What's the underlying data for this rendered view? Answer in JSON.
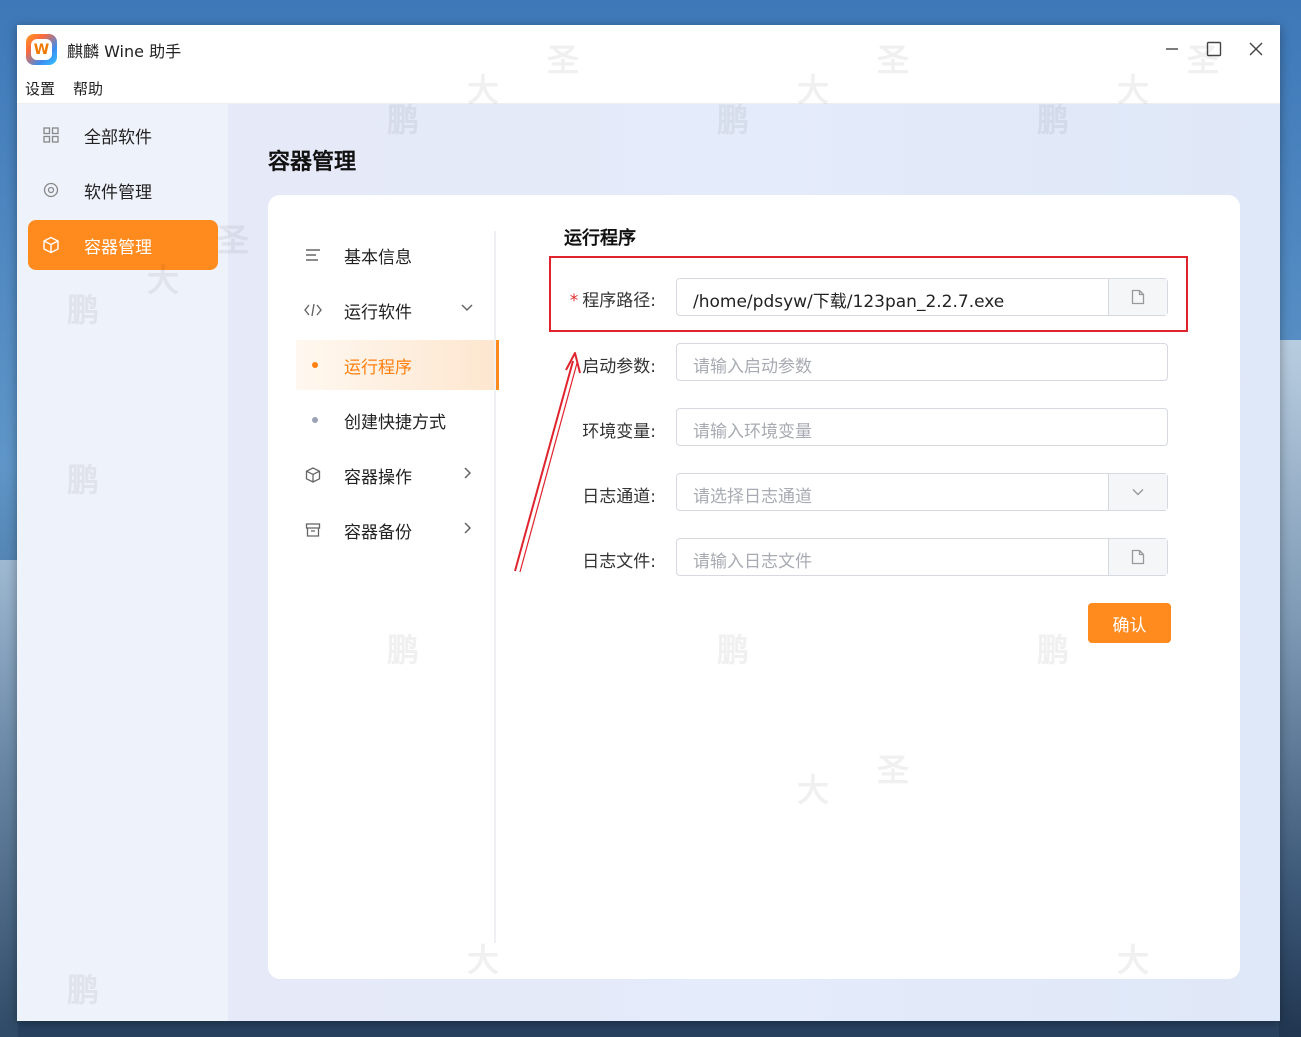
{
  "window": {
    "title": "麒麟 Wine 助手",
    "logo_letter": "W"
  },
  "window_controls": {
    "minimize": "—",
    "maximize": "☐",
    "close": "✕"
  },
  "menubar": {
    "items": [
      "设置",
      "帮助"
    ]
  },
  "sidebar": {
    "items": [
      {
        "label": "全部软件",
        "icon": "grid-icon"
      },
      {
        "label": "软件管理",
        "icon": "gear-icon"
      },
      {
        "label": "容器管理",
        "icon": "cube-icon",
        "active": true
      }
    ]
  },
  "page": {
    "title": "容器管理"
  },
  "submenu": {
    "items": [
      {
        "label": "基本信息",
        "icon": "list-icon"
      },
      {
        "label": "运行软件",
        "icon": "code-icon",
        "expanded": true
      },
      {
        "label": "运行程序",
        "sub": true,
        "active": true
      },
      {
        "label": "创建快捷方式",
        "sub": true
      },
      {
        "label": "容器操作",
        "icon": "cube-icon"
      },
      {
        "label": "容器备份",
        "icon": "archive-icon"
      }
    ]
  },
  "form": {
    "section_title": "运行程序",
    "required_mark": "*",
    "fields": [
      {
        "label": "程序路径:",
        "value": "/home/pdsyw/下载/123pan_2.2.7.exe",
        "placeholder": "",
        "suffix": "file-icon",
        "required": true
      },
      {
        "label": "启动参数:",
        "value": "",
        "placeholder": "请输入启动参数"
      },
      {
        "label": "环境变量:",
        "value": "",
        "placeholder": "请输入环境变量"
      },
      {
        "label": "日志通道:",
        "value": "",
        "placeholder": "请选择日志通道",
        "suffix": "chevron-down-icon"
      },
      {
        "label": "日志文件:",
        "value": "",
        "placeholder": "请输入日志文件",
        "suffix": "file-icon"
      }
    ],
    "confirm_label": "确认"
  },
  "accent_color": "#ff8a1e",
  "annotation_color": "#e0242e",
  "watermark": [
    "鹏",
    "大",
    "圣"
  ]
}
